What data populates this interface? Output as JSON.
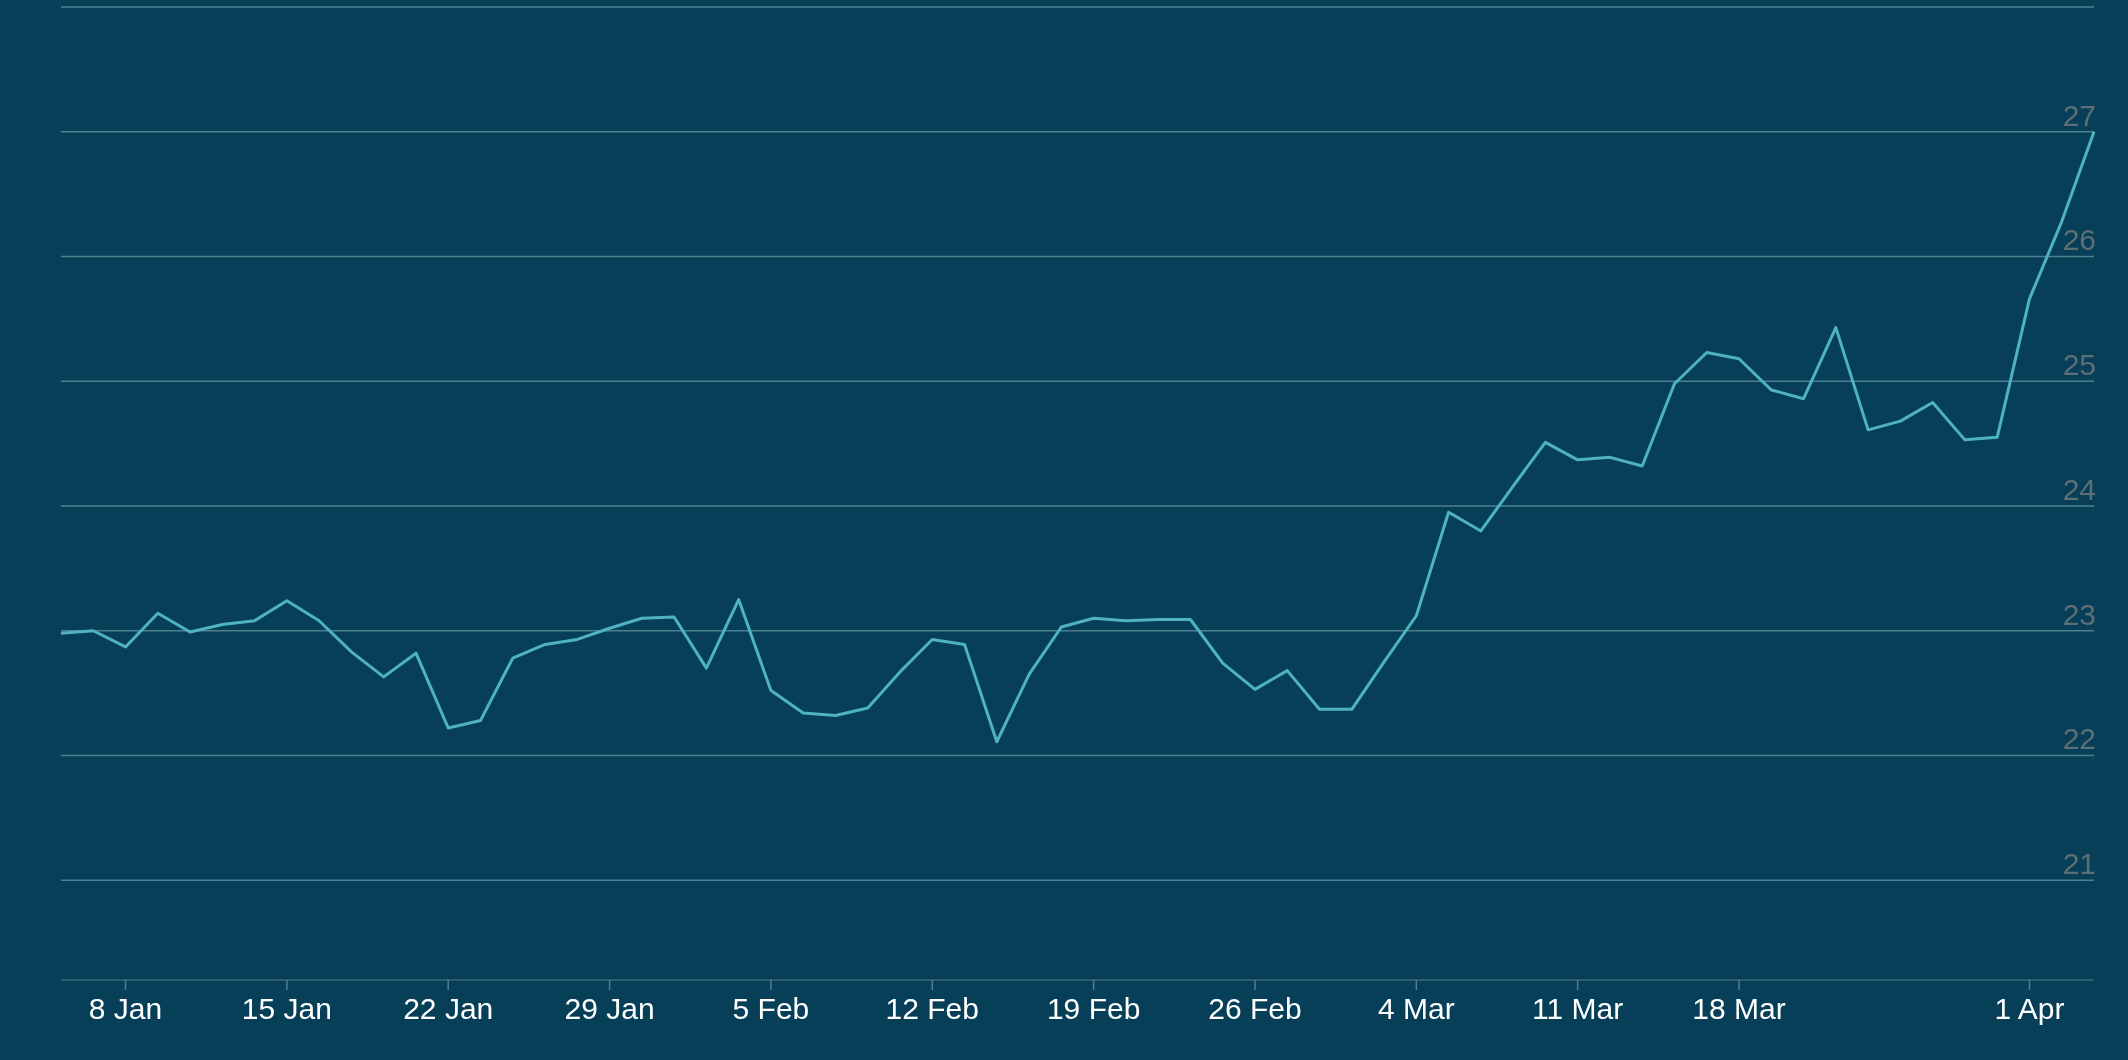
{
  "chart_data": {
    "type": "line",
    "categories": [
      null,
      null,
      "8 Jan",
      null,
      null,
      null,
      null,
      "15 Jan",
      null,
      null,
      null,
      null,
      "22 Jan",
      null,
      null,
      null,
      null,
      "29 Jan",
      null,
      null,
      null,
      null,
      "5 Feb",
      null,
      null,
      null,
      null,
      "12 Feb",
      null,
      null,
      null,
      null,
      "19 Feb",
      null,
      null,
      null,
      null,
      "26 Feb",
      null,
      null,
      null,
      null,
      "4 Mar",
      null,
      null,
      null,
      null,
      "11 Mar",
      null,
      null,
      null,
      null,
      "18 Mar",
      null,
      null,
      null,
      null,
      null,
      null,
      null,
      null,
      "1 Apr",
      null,
      null
    ],
    "series": [
      {
        "color": "#4fb3bf",
        "values": [
          22.98,
          23.0,
          22.87,
          23.14,
          22.99,
          23.05,
          23.08,
          23.24,
          23.08,
          22.83,
          22.63,
          22.82,
          22.22,
          22.28,
          22.78,
          22.89,
          22.93,
          23.02,
          23.1,
          23.11,
          22.7,
          23.25,
          22.52,
          22.34,
          22.32,
          22.38,
          22.67,
          22.93,
          22.89,
          22.11,
          22.65,
          23.03,
          23.1,
          23.08,
          23.09,
          23.09,
          22.74,
          22.53,
          22.68,
          22.37,
          22.37,
          22.75,
          23.12,
          23.95,
          23.8,
          24.16,
          24.51,
          24.37,
          24.39,
          24.32,
          24.98,
          25.23,
          25.18,
          24.93,
          24.86,
          25.43,
          24.61,
          24.68,
          24.83,
          24.53,
          24.55,
          25.66,
          26.28,
          27.0
        ]
      }
    ],
    "ylim": [
      20.2,
      28
    ],
    "grid": true,
    "yticks": [
      21,
      22,
      23,
      24,
      25,
      26,
      27
    ]
  }
}
